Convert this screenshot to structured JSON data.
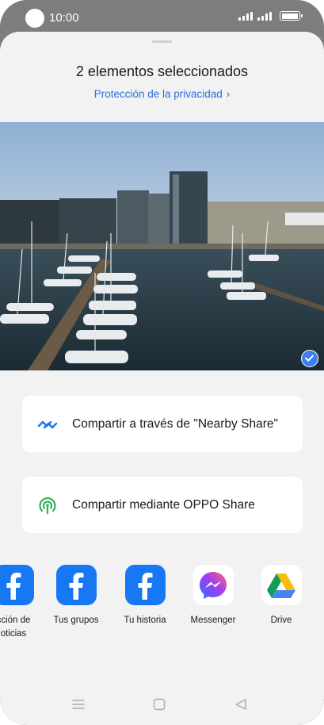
{
  "status_bar": {
    "time": "10:00"
  },
  "sheet": {
    "title": "2 elementos seleccionados",
    "privacy_link": "Protección de la privacidad",
    "privacy_chevron": "›"
  },
  "photo": {
    "selected": true
  },
  "share_options": [
    {
      "label": "Compartir a través de \"Nearby Share\"",
      "icon": "nearby-share-icon",
      "color": "#1a73e8"
    },
    {
      "label": "Compartir mediante OPPO Share",
      "icon": "oppo-share-icon",
      "color": "#2fb35a"
    }
  ],
  "apps": [
    {
      "label_line1": "cción de",
      "label_line2": "oticias",
      "icon": "facebook-icon"
    },
    {
      "label_line1": "Tus grupos",
      "label_line2": "",
      "icon": "facebook-icon"
    },
    {
      "label_line1": "Tu historia",
      "label_line2": "",
      "icon": "facebook-icon"
    },
    {
      "label_line1": "Messenger",
      "label_line2": "",
      "icon": "messenger-icon"
    },
    {
      "label_line1": "Drive",
      "label_line2": "",
      "icon": "drive-icon"
    }
  ],
  "colors": {
    "accent": "#2b6fd8",
    "facebook": "#1877f2",
    "check": "#3b7ff0"
  }
}
